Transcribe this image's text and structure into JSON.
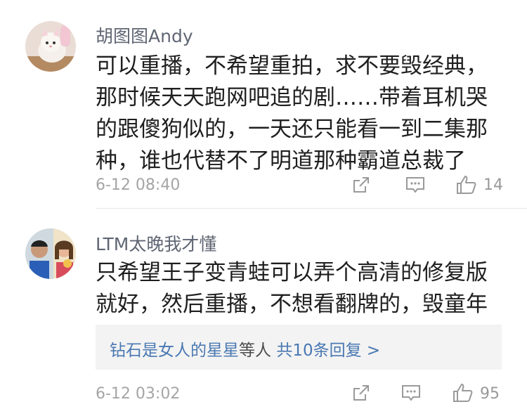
{
  "comments": [
    {
      "username": "胡图图Andy",
      "text": "可以重播，不希望重拍，求不要毁经典，那时候天天跑网吧追的剧……带着耳机哭的跟傻狗似的，一天还只能看一到二集那种，谁也代替不了明道那种霸道总裁了",
      "timestamp": "6-12 08:40",
      "likes": "14"
    },
    {
      "username": "LTM太晚我才懂",
      "text": "只希望王子变青蛙可以弄个高清的修复版就好，然后重播，不想看翻牌的，毁童年",
      "timestamp": "6-12 03:02",
      "likes": "95",
      "replies": {
        "users": "钻石是女人的星星",
        "connector": "等人",
        "count": "共10条回复 >"
      }
    }
  ],
  "icons": {
    "share": "share-icon",
    "comment": "comment-icon",
    "like": "thumbs-up-icon"
  },
  "colors": {
    "username": "#5f6673",
    "body": "#1f1f1f",
    "meta": "#a5a5a5",
    "link": "#4a78b2",
    "reply_bg": "#f3f3f3"
  }
}
